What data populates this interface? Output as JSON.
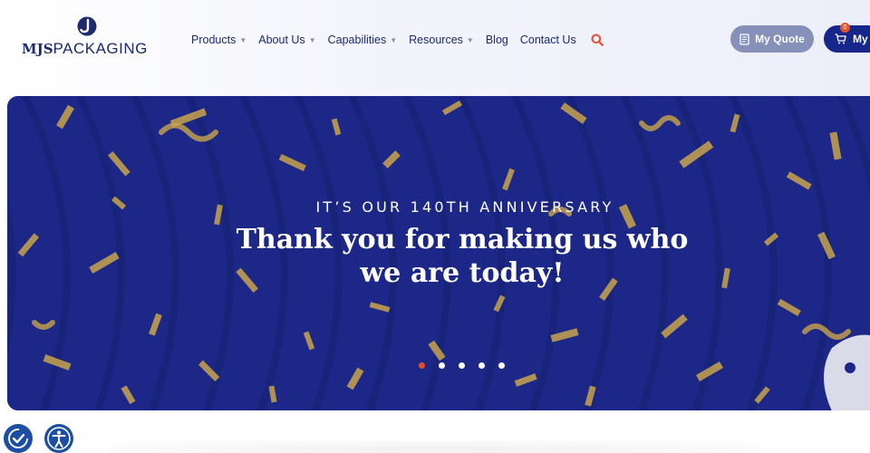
{
  "brand": {
    "logo_text_bold": "MJS",
    "logo_text_rest": "PACKAGING",
    "logo_icon": "mjs-j-mark-icon"
  },
  "nav": {
    "items": [
      {
        "label": "Products",
        "has_dropdown": true
      },
      {
        "label": "About Us",
        "has_dropdown": true
      },
      {
        "label": "Capabilities",
        "has_dropdown": true
      },
      {
        "label": "Resources",
        "has_dropdown": true
      },
      {
        "label": "Blog",
        "has_dropdown": false
      },
      {
        "label": "Contact Us",
        "has_dropdown": false
      }
    ],
    "search_icon": "search-icon"
  },
  "header_actions": {
    "quote_label": "My Quote",
    "quote_icon": "quote-document-icon",
    "cart_label": "My",
    "cart_icon": "cart-icon",
    "cart_count": "0"
  },
  "hero": {
    "eyebrow": "IT’S OUR 140TH ANNIVERSARY",
    "title": "Thank you for making us who we are today!",
    "slide_count": 5,
    "active_slide": 1
  },
  "widgets": {
    "left_icon": "accessibility-checkmark-icon",
    "right_icon": "accessibility-person-icon"
  },
  "colors": {
    "brand_navy": "#1c2a6e",
    "hero_blue": "#1c2788",
    "accent_orange": "#e2512b",
    "quote_button": "#8790b8",
    "cart_button": "#16268a",
    "confetti_gold": "#c9a54a"
  }
}
